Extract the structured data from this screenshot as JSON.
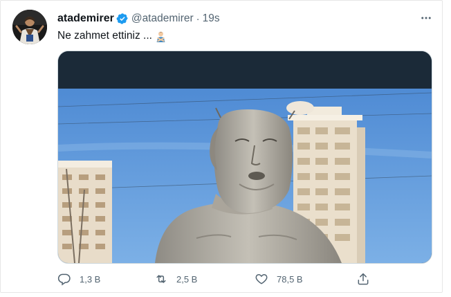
{
  "tweet": {
    "author_name": "atademirer",
    "author_handle": "@atademirer",
    "separator": "·",
    "time": "19s",
    "text": "Ne zahmet ettiniz ...",
    "emoji": "man-gesturing-no"
  },
  "icons": {
    "verified": "verified-badge-icon",
    "more": "more-horizontal-icon",
    "reply": "reply-icon",
    "retweet": "retweet-icon",
    "like": "heart-icon",
    "share": "share-icon"
  },
  "stats": {
    "replies": "1,3 B",
    "retweets": "2,5 B",
    "likes": "78,5 B"
  },
  "colors": {
    "verified_blue": "#1d9bf0",
    "muted_text": "#536471",
    "sky": "#5a93d6"
  }
}
